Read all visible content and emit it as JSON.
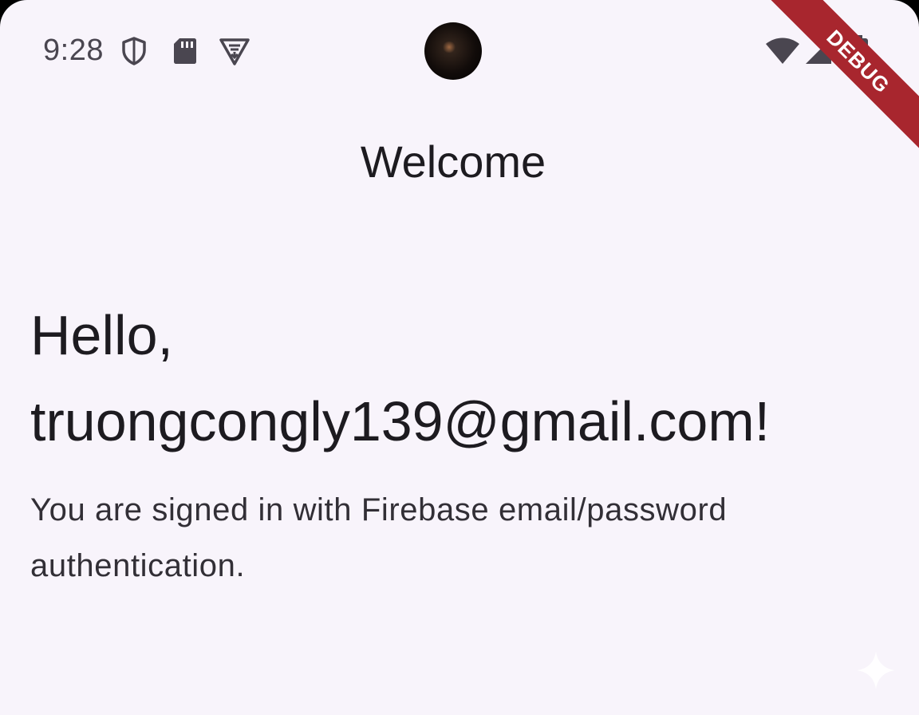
{
  "status_bar": {
    "time": "9:28",
    "left_icons": [
      "shield-icon",
      "sd-card-icon",
      "vpn-icon"
    ],
    "right_icons": [
      "wifi-icon",
      "signal-icon",
      "battery-icon"
    ]
  },
  "debug_banner": {
    "label": "DEBUG",
    "color": "#a8262e"
  },
  "app_bar": {
    "title": "Welcome"
  },
  "main": {
    "greeting": "Hello, truongcongly139@gmail.com!",
    "message": "You are signed in with Firebase email/password authentication."
  },
  "colors": {
    "background": "#f8f4fb",
    "text_primary": "#1d1b20",
    "text_secondary": "#322f36"
  }
}
